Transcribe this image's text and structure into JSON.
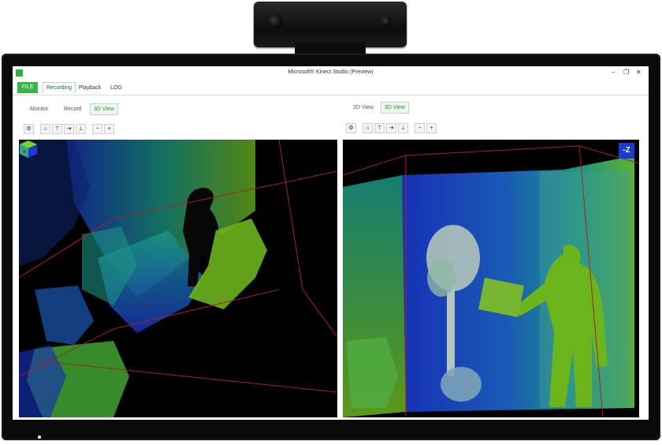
{
  "window": {
    "title": "Microsoft® Kinect Studio (Preview)",
    "minimize": "–",
    "restore": "❐",
    "close": "✕"
  },
  "ribbon": {
    "file_tab": "FILE",
    "tabs": [
      "Recording",
      "Playback",
      "LOG"
    ],
    "active_tab": "Recording"
  },
  "left_pane": {
    "views": [
      "Monitor",
      "Record",
      "3D View"
    ],
    "active_view": "3D View",
    "toolbar": [
      {
        "icon": "gear-icon",
        "glyph": "⚙"
      },
      {
        "icon": "home-icon",
        "glyph": "⌂"
      },
      {
        "icon": "align-top-icon",
        "glyph": "⊤"
      },
      {
        "icon": "align-side-icon",
        "glyph": "⇥"
      },
      {
        "icon": "align-bottom-icon",
        "glyph": "⊥"
      },
      {
        "icon": "zoom-out-icon",
        "glyph": "−"
      },
      {
        "icon": "zoom-in-icon",
        "glyph": "+"
      }
    ]
  },
  "right_pane": {
    "views": [
      "2D View",
      "3D View"
    ],
    "active_view": "3D View",
    "toolbar": [
      {
        "icon": "gear-icon",
        "glyph": "⚙"
      },
      {
        "icon": "home-icon",
        "glyph": "⌂"
      },
      {
        "icon": "align-top-icon",
        "glyph": "⊤"
      },
      {
        "icon": "align-side-icon",
        "glyph": "⇥"
      },
      {
        "icon": "align-bottom-icon",
        "glyph": "⊥"
      },
      {
        "icon": "zoom-out-icon",
        "glyph": "−"
      },
      {
        "icon": "zoom-in-icon",
        "glyph": "+"
      }
    ],
    "axis_badge": "-Z"
  },
  "colors": {
    "accent_green": "#37b44a",
    "depth_near": "#7ed321",
    "depth_mid": "#1fae9a",
    "depth_far": "#1a3ad6",
    "frustum": "#c0282b"
  }
}
